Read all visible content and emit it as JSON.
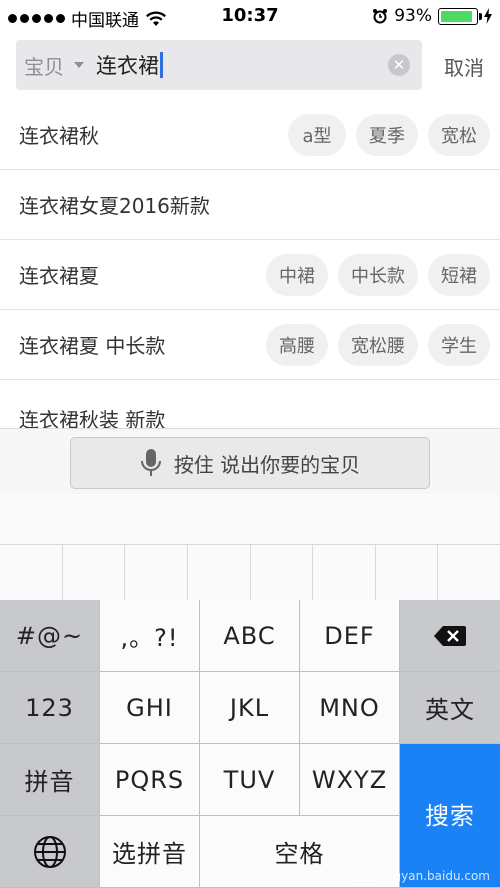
{
  "status_bar": {
    "carrier": "中国联通",
    "time": "10:37",
    "battery": "93%",
    "battery_level": 0.93
  },
  "search": {
    "scope_label": "宝贝",
    "query": "连衣裙",
    "cancel_label": "取消"
  },
  "suggestions": [
    {
      "text": "连衣裙秋",
      "chips": [
        "a型",
        "夏季",
        "宽松"
      ]
    },
    {
      "text": "连衣裙女夏2016新款",
      "chips": []
    },
    {
      "text": "连衣裙夏",
      "chips": [
        "中裙",
        "中长款",
        "短裙"
      ]
    },
    {
      "text": "连衣裙夏 中长款",
      "chips": [
        "高腰",
        "宽松腰",
        "学生"
      ]
    },
    {
      "text": "连衣裙秋装 新款",
      "chips": []
    }
  ],
  "voice": {
    "label": "按住  说出你要的宝贝"
  },
  "keyboard": {
    "row1": [
      "#@~",
      ",。?!",
      "ABC",
      "DEF"
    ],
    "row2": [
      "123",
      "GHI",
      "JKL",
      "MNO",
      "英文"
    ],
    "row3": [
      "拼音",
      "PQRS",
      "TUV",
      "WXYZ"
    ],
    "row4_select": "选拼音",
    "row4_space": "空格",
    "search_label": "搜索"
  },
  "colors": {
    "search_key": "#1a82f5",
    "battery_fill": "#4cd964",
    "cursor": "#2f6fde"
  },
  "watermark": "Baidu经验 jingyan.baidu.com"
}
